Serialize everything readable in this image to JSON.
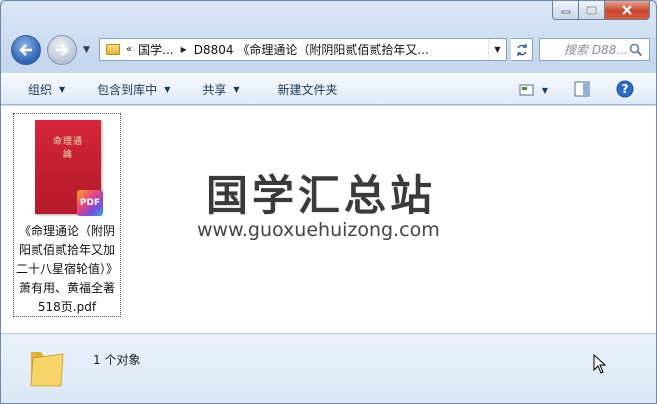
{
  "address": {
    "chevrons": "«",
    "crumb1": "国学...",
    "crumb2": "D8804 《命理通论（附阴阳贰佰贰拾年又...",
    "search_placeholder": "搜索 D88..."
  },
  "toolbar": {
    "organize": "组织",
    "include_library": "包含到库中",
    "share": "共享",
    "new_folder": "新建文件夹"
  },
  "file": {
    "name": "《命理通论（附阴阳贰佰贰拾年又加二十八星宿轮值）》萧有用、黄福全著 518页.pdf",
    "badge": "PDF",
    "thumb_title": "命理通論"
  },
  "watermark": {
    "title": "国学汇总站",
    "url": "www.guoxuehuizong.com"
  },
  "status": {
    "count": "1 个对象"
  },
  "colors": {
    "accent": "#1e395b",
    "cover_red": "#c01e30",
    "close_red": "#c8462e"
  }
}
